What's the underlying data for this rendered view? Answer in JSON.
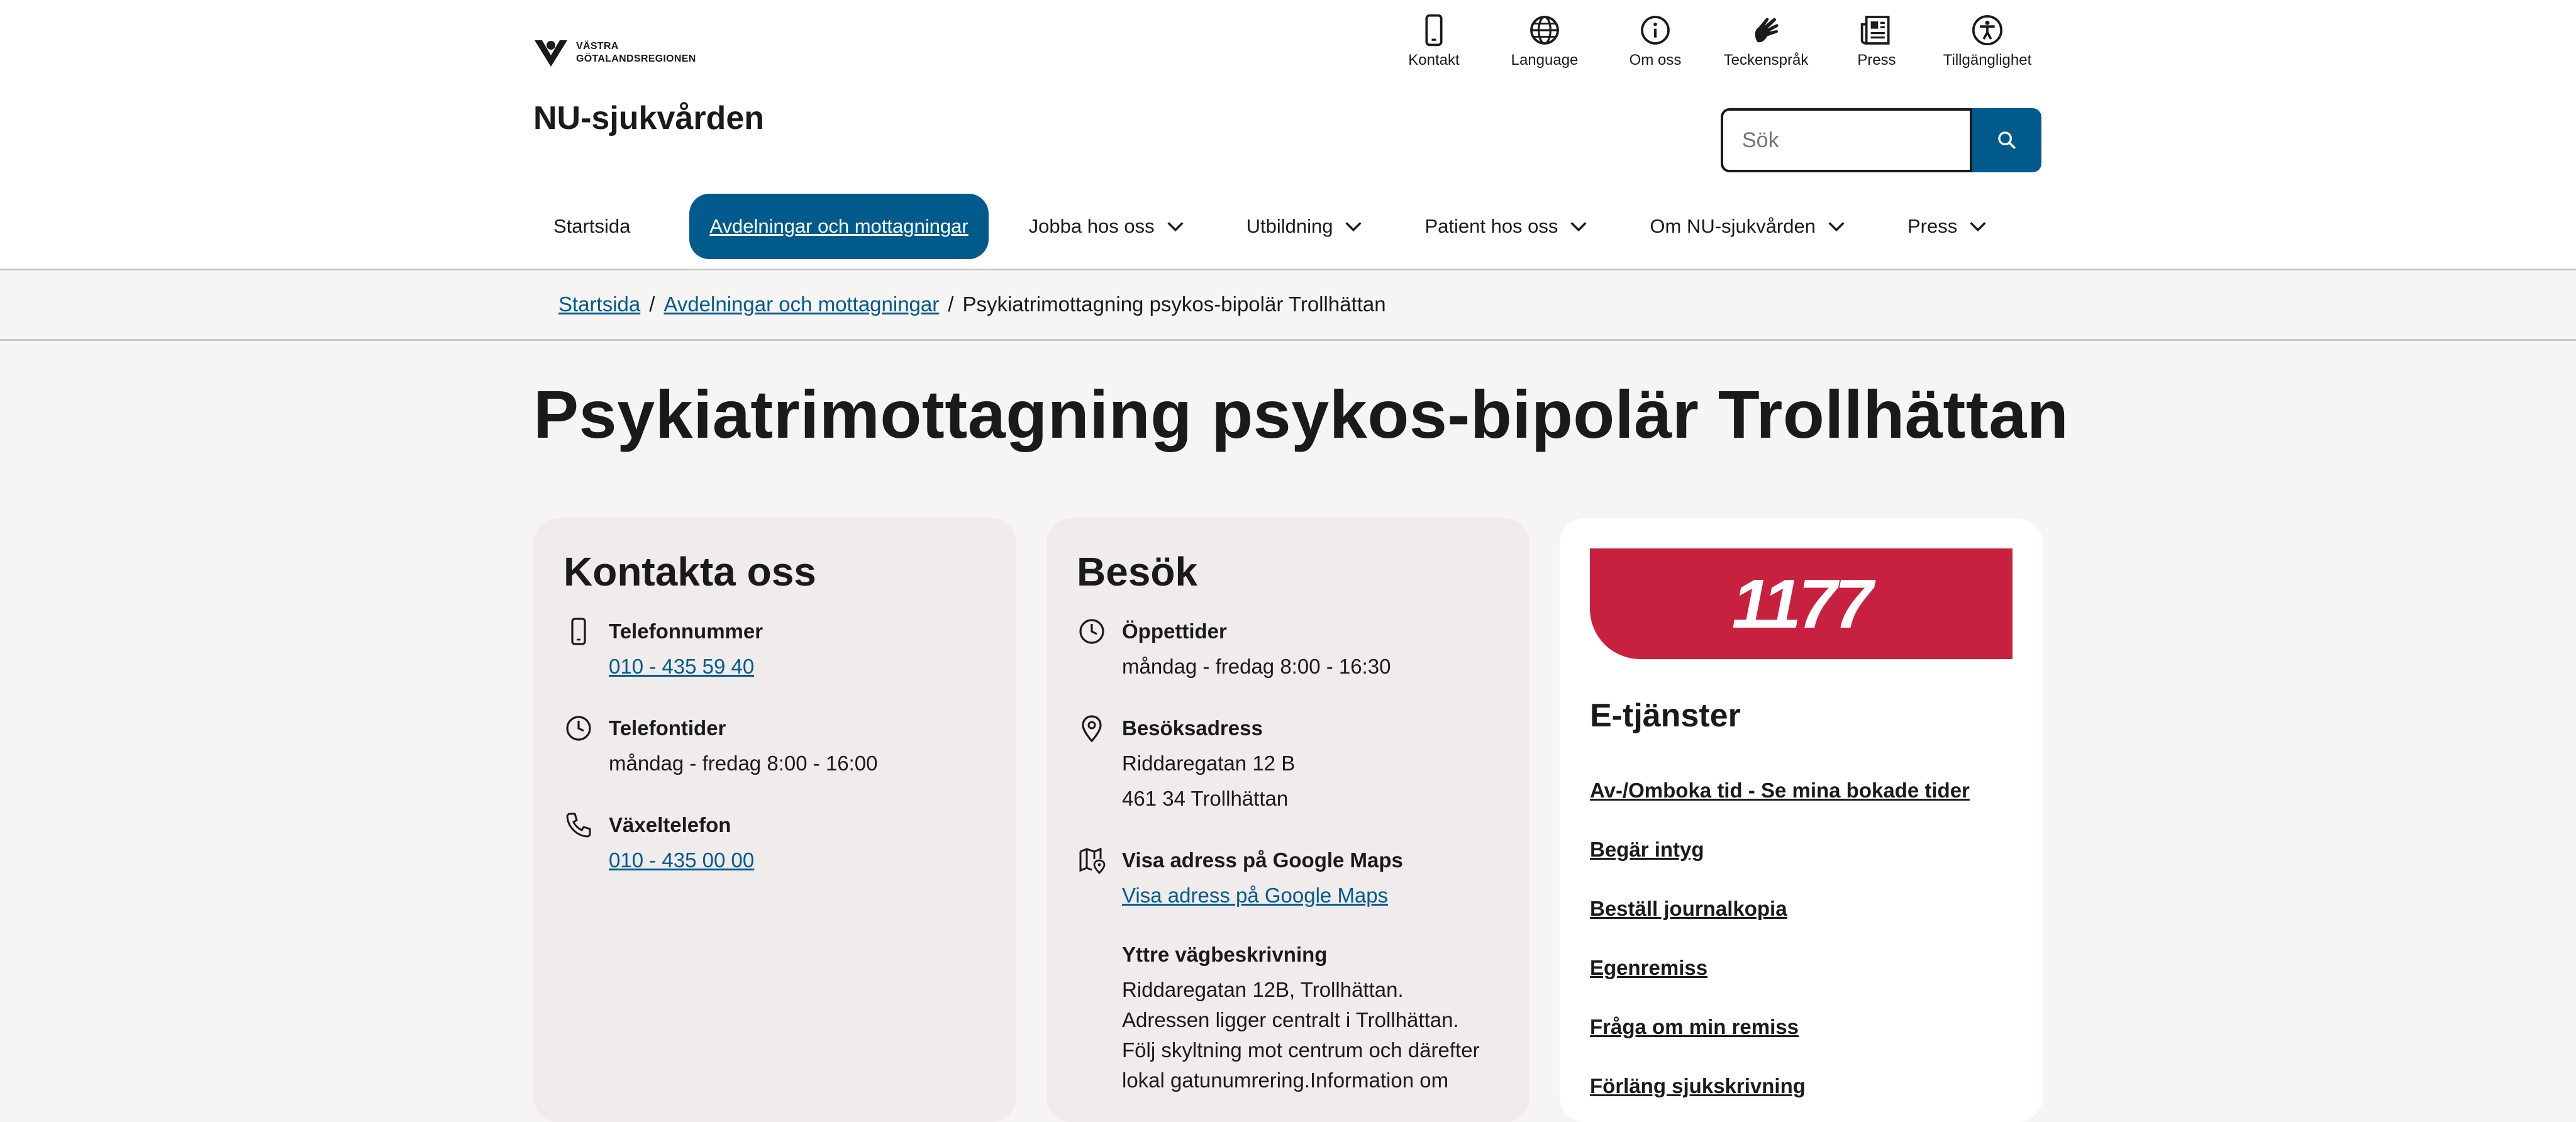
{
  "header": {
    "logo_line1": "VÄSTRA",
    "logo_line2": "GÖTALANDSREGIONEN",
    "site_title": "NU-sjukvården",
    "utility": [
      {
        "label": "Kontakt",
        "icon": "phone-icon"
      },
      {
        "label": "Language",
        "icon": "globe-icon"
      },
      {
        "label": "Om oss",
        "icon": "info-icon"
      },
      {
        "label": "Teckenspråk",
        "icon": "sign-language-icon"
      },
      {
        "label": "Press",
        "icon": "newspaper-icon"
      },
      {
        "label": "Tillgänglighet",
        "icon": "accessibility-icon"
      }
    ],
    "search_placeholder": "Sök"
  },
  "nav": {
    "items": [
      {
        "label": "Startsida"
      },
      {
        "label": "Avdelningar och mottagningar",
        "active": true
      },
      {
        "label": "Jobba hos oss"
      },
      {
        "label": "Utbildning"
      },
      {
        "label": "Patient hos oss"
      },
      {
        "label": "Om NU-sjukvården"
      },
      {
        "label": "Press"
      }
    ]
  },
  "breadcrumb": {
    "home": "Startsida",
    "section": "Avdelningar och mottagningar",
    "sep": "/",
    "current": "Psykiatrimottagning psykos-bipolär Trollhättan"
  },
  "page_title": "Psykiatrimottagning psykos-bipolär Trollhättan",
  "contact": {
    "title": "Kontakta oss",
    "phone_label": "Telefonnummer",
    "phone": "010 - 435 59 40",
    "hours_label": "Telefontider",
    "hours": "måndag - fredag 8:00 - 16:00",
    "switch_label": "Växeltelefon",
    "switch": "010 - 435 00 00"
  },
  "visit": {
    "title": "Besök",
    "open_label": "Öppettider",
    "open": "måndag - fredag 8:00 - 16:30",
    "address_label": "Besöksadress",
    "address1": "Riddaregatan 12 B",
    "address2": "461 34 Trollhättan",
    "maps_label": "Visa adress på Google Maps",
    "maps_link": "Visa adress på Google Maps",
    "directions_label": "Yttre vägbeskrivning",
    "directions1": "Riddaregatan 12B, Trollhättan.",
    "directions2": "Adressen ligger centralt i Trollhättan.",
    "directions3": "Följ skyltning mot centrum och därefter",
    "directions4": "lokal gatunumrering.Information om"
  },
  "eservices": {
    "brand": "1177",
    "title": "E-tjänster",
    "links": [
      "Av-/Omboka tid - Se mina bokade tider",
      "Begär intyg",
      "Beställ journalkopia",
      "Egenremiss",
      "Fråga om min remiss",
      "Förläng sjukskrivning"
    ]
  },
  "colors": {
    "primary": "#005a8c",
    "brand_1177": "#c8203f",
    "background": "#f6f5f4"
  }
}
